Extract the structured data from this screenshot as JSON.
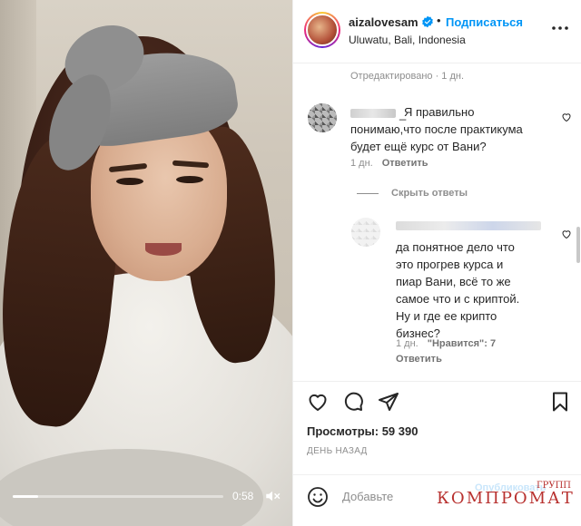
{
  "video": {
    "time": "0:58",
    "progress": 0.12
  },
  "header": {
    "username": "aizalovesam",
    "follow_label": "Подписаться",
    "location": "Uluwatu, Bali, Indonesia"
  },
  "caption_meta": "Отредактировано · 1 дн.",
  "comments": [
    {
      "name_blurred": "_____________",
      "text": "Я правильно\nпонимаю,что после практикума\nбудет ещё курс от Вани?",
      "time": "1 дн.",
      "reply_label": "Ответить"
    }
  ],
  "hide_replies_label": "Скрыть ответы",
  "replies": [
    {
      "text": "да понятное дело что\nэто прогрев курса и\nпиар Вани, всё то же\nсамое что и с криптой.\nНу и где ее крипто\nбизнес?",
      "time": "1 дн.",
      "likes": "\"Нравится\": 7",
      "reply_label": "Ответить"
    }
  ],
  "post": {
    "views": "Просмотры: 59 390",
    "date": "ДЕНЬ НАЗАД"
  },
  "add_comment": {
    "placeholder": "Добавьте",
    "watermark": "КОМПРОМАТ",
    "watermark_sup": "ГРУПП",
    "faint_watermark": "Опубликовать"
  },
  "colors": {
    "link_blue": "#0095f6",
    "watermark_red": "#b8312f"
  }
}
